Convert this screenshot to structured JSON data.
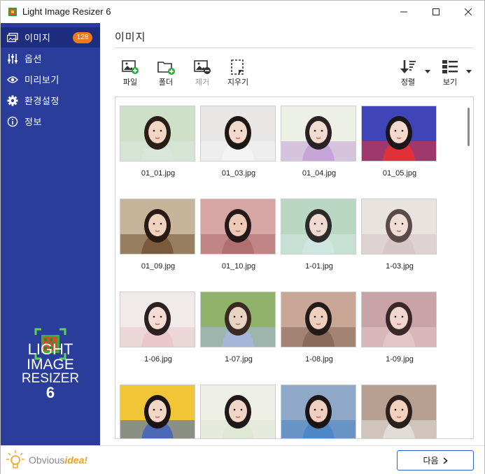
{
  "window": {
    "title": "Light Image Resizer 6"
  },
  "sidebar": {
    "items": [
      {
        "label": "이미지",
        "icon": "images-icon",
        "badge": "128",
        "active": true
      },
      {
        "label": "옵션",
        "icon": "sliders-icon"
      },
      {
        "label": "미리보기",
        "icon": "eye-icon"
      },
      {
        "label": "환경설정",
        "icon": "gear-icon"
      },
      {
        "label": "정보",
        "icon": "info-icon"
      }
    ],
    "brand": {
      "line1": "LIGHT",
      "line2": "IMAGE",
      "line3": "RESIZER",
      "line4": "6"
    },
    "footer": {
      "brand_plain": "Obvious",
      "brand_accent": "idea!"
    }
  },
  "main": {
    "title": "이미지",
    "toolbar": {
      "file": "파일",
      "folder": "폴더",
      "remove": "제거",
      "clear": "지우기",
      "sort": "정렬",
      "view": "보기"
    },
    "thumbnails": [
      {
        "name": "01_01.jpg",
        "bg": "#cfe0c8",
        "skin": "#f2d6c4",
        "hair": "#2a1d18",
        "accent": "#d8e6dc"
      },
      {
        "name": "01_03.jpg",
        "bg": "#e9e7e6",
        "skin": "#f1d9cc",
        "hair": "#1d1714",
        "accent": "#f3f3f3"
      },
      {
        "name": "01_04.jpg",
        "bg": "#edf0e6",
        "skin": "#f2dcd0",
        "hair": "#2a2222",
        "accent": "#c6a6d8"
      },
      {
        "name": "01_05.jpg",
        "bg": "#3f45b8",
        "skin": "#f4d9cc",
        "hair": "#1c1618",
        "accent": "#e0313a"
      },
      {
        "name": "01_09.jpg",
        "bg": "#c6b59a",
        "skin": "#f0d3bf",
        "hair": "#2a1a14",
        "accent": "#7a5a3a"
      },
      {
        "name": "01_10.jpg",
        "bg": "#d7a5a2",
        "skin": "#efc8b8",
        "hair": "#24181a",
        "accent": "#b07070"
      },
      {
        "name": "1-01.jpg",
        "bg": "#b9d8c3",
        "skin": "#eedad0",
        "hair": "#2d2a2a",
        "accent": "#cfe6e0"
      },
      {
        "name": "1-03.jpg",
        "bg": "#e9e3e0",
        "skin": "#f1ddd5",
        "hair": "#5a4a4a",
        "accent": "#d7c8c8"
      },
      {
        "name": "1-06.jpg",
        "bg": "#f1eaea",
        "skin": "#f5ddd6",
        "hair": "#2a2020",
        "accent": "#e8c8cc"
      },
      {
        "name": "1-07.jpg",
        "bg": "#8fb36a",
        "skin": "#e9d4c4",
        "hair": "#3a2a22",
        "accent": "#a6b6d8"
      },
      {
        "name": "1-08.jpg",
        "bg": "#c9a796",
        "skin": "#efd0c0",
        "hair": "#241a18",
        "accent": "#8a6a5a"
      },
      {
        "name": "1-09.jpg",
        "bg": "#c8a4a8",
        "skin": "#f1d6cf",
        "hair": "#3a2828",
        "accent": "#e3c4c8"
      },
      {
        "name": "",
        "bg": "#f0c536",
        "skin": "#f1d7c6",
        "hair": "#1c1414",
        "accent": "#4a6ab8"
      },
      {
        "name": "",
        "bg": "#eef0e8",
        "skin": "#f0d6c6",
        "hair": "#1f1818",
        "accent": "#dfe8d4"
      },
      {
        "name": "",
        "bg": "#8fa8c8",
        "skin": "#efd0bf",
        "hair": "#1a1414",
        "accent": "#4e88c4"
      },
      {
        "name": "",
        "bg": "#b7a092",
        "skin": "#f0d2bf",
        "hair": "#2c201c",
        "accent": "#e2dcd8"
      }
    ]
  },
  "footer": {
    "next_label": "다음"
  },
  "colors": {
    "sidebar": "#2b3d9b",
    "sidebar_active": "#1e2d80",
    "badge": "#f07a18",
    "primary_border": "#2b62c6"
  }
}
